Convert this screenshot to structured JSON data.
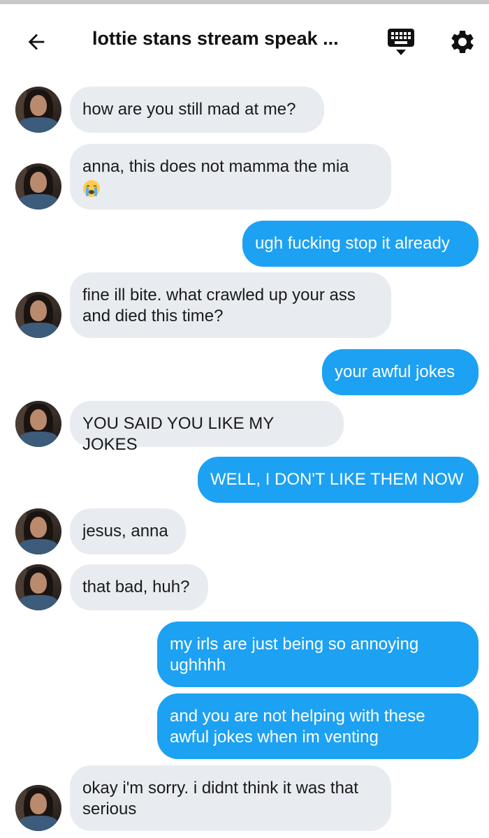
{
  "header": {
    "title": "lottie stans stream speak ...",
    "back_icon": "back-arrow-icon",
    "keyboard_icon": "keyboard-icon",
    "settings_icon": "gear-icon"
  },
  "colors": {
    "incoming_bubble": "#e8ecf1",
    "outgoing_bubble": "#1da1f2",
    "outgoing_text": "#ffffff",
    "incoming_text": "#1a1a1a"
  },
  "messages": [
    {
      "from": "them",
      "text": "how are you still mad at me?"
    },
    {
      "from": "them",
      "text": "anna, this does not mamma the mia",
      "emoji": "crying-face-icon"
    },
    {
      "from": "me",
      "text": "ugh fucking stop it already"
    },
    {
      "from": "them",
      "text": "fine ill bite. what crawled up your ass and died this time?"
    },
    {
      "from": "me",
      "text": "your awful jokes"
    },
    {
      "from": "them",
      "text": "YOU SAID YOU LIKE MY JOKES"
    },
    {
      "from": "me",
      "text": "WELL, I DON'T LIKE THEM NOW"
    },
    {
      "from": "them",
      "text": "jesus, anna"
    },
    {
      "from": "them",
      "text": "that bad, huh?"
    },
    {
      "from": "me",
      "text": "my irls are just being so annoying ughhhh"
    },
    {
      "from": "me",
      "text": "and you are not helping with these awful jokes when im venting"
    },
    {
      "from": "them",
      "text": "okay i'm sorry. i didnt think it was that serious"
    }
  ]
}
